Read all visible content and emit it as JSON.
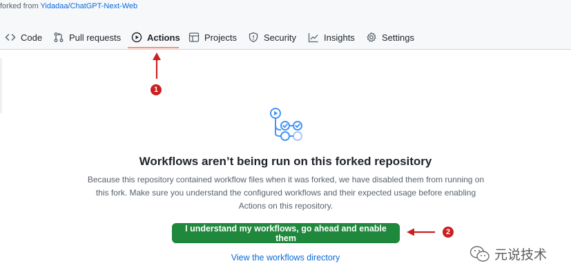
{
  "header": {
    "forked_prefix": "forked from",
    "forked_repo": "Yidadaa/ChatGPT-Next-Web"
  },
  "tabs": [
    {
      "label": "Code",
      "icon": "code-icon"
    },
    {
      "label": "Pull requests",
      "icon": "pull-request-icon"
    },
    {
      "label": "Actions",
      "icon": "play-icon",
      "active": true
    },
    {
      "label": "Projects",
      "icon": "table-icon"
    },
    {
      "label": "Security",
      "icon": "shield-icon"
    },
    {
      "label": "Insights",
      "icon": "graph-icon"
    },
    {
      "label": "Settings",
      "icon": "gear-icon"
    }
  ],
  "annotations": {
    "badge_1": "1",
    "badge_2": "2",
    "color": "#cc1f1f"
  },
  "main": {
    "icon": "workflow-icon",
    "title": "Workflows aren’t being run on this forked repository",
    "description": "Because this repository contained workflow files when it was forked, we have disabled them from running on this fork. Make sure you understand the configured workflows and their expected usage before enabling Actions on this repository.",
    "enable_button": "I understand my workflows, go ahead and enable them",
    "view_link": "View the workflows directory"
  },
  "watermark": {
    "text": "元说技术"
  },
  "colors": {
    "accent_underline": "#fd8c73",
    "button_green": "#1f883d",
    "link_blue": "#0969da",
    "icon_blue": "#4493f8"
  }
}
